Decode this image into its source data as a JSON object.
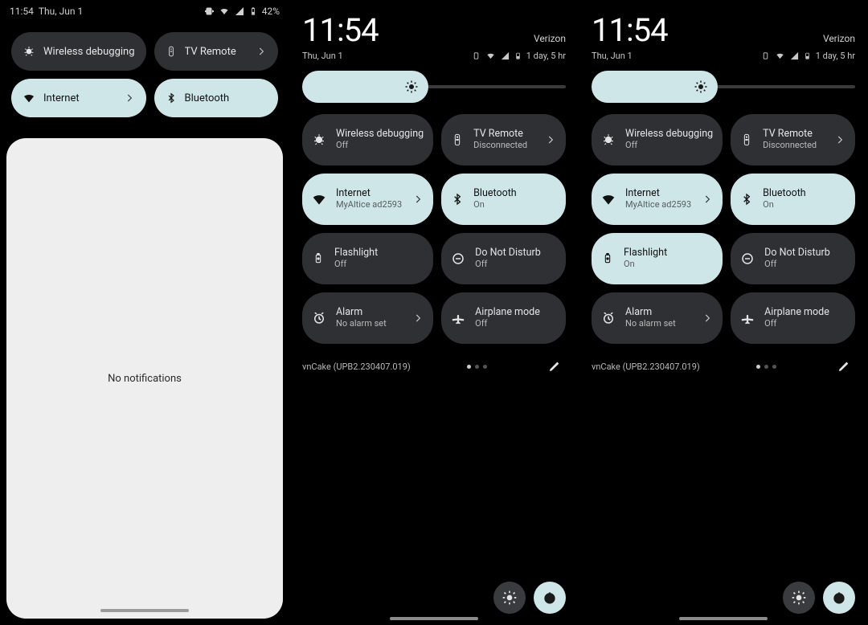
{
  "screen1": {
    "status": {
      "time": "11:54",
      "date": "Thu, Jun 1",
      "battery": "42%"
    },
    "tiles": {
      "wireless_dbg": "Wireless debugging",
      "tv_remote": "TV Remote",
      "internet": "Internet",
      "bluetooth": "Bluetooth"
    },
    "no_notifications": "No notifications"
  },
  "screen2": {
    "clock": "11:54",
    "carrier": "Verizon",
    "date": "Thu, Jun 1",
    "battery_est": "1 day, 5 hr",
    "tiles": [
      {
        "id": "wireless-debugging",
        "title": "Wireless debugging",
        "sub": "Off",
        "active": false,
        "chev": false,
        "icon": "bug"
      },
      {
        "id": "tv-remote",
        "title": "TV Remote",
        "sub": "Disconnected",
        "active": false,
        "chev": true,
        "icon": "remote"
      },
      {
        "id": "internet",
        "title": "Internet",
        "sub": "MyAltice ad2593",
        "active": true,
        "chev": true,
        "icon": "wifi"
      },
      {
        "id": "bluetooth",
        "title": "Bluetooth",
        "sub": "On",
        "active": true,
        "chev": false,
        "icon": "bt"
      },
      {
        "id": "flashlight",
        "title": "Flashlight",
        "sub": "Off",
        "active": false,
        "chev": false,
        "icon": "flash"
      },
      {
        "id": "dnd",
        "title": "Do Not Disturb",
        "sub": "Off",
        "active": false,
        "chev": false,
        "icon": "dnd"
      },
      {
        "id": "alarm",
        "title": "Alarm",
        "sub": "No alarm set",
        "active": false,
        "chev": true,
        "icon": "alarm"
      },
      {
        "id": "airplane",
        "title": "Airplane mode",
        "sub": "Off",
        "active": false,
        "chev": false,
        "icon": "plane"
      }
    ],
    "build": "vnCake (UPB2.230407.019)"
  },
  "screen3": {
    "clock": "11:54",
    "carrier": "Verizon",
    "date": "Thu, Jun 1",
    "battery_est": "1 day, 5 hr",
    "tiles": [
      {
        "id": "wireless-debugging",
        "title": "Wireless debugging",
        "sub": "Off",
        "active": false,
        "chev": false,
        "icon": "bug"
      },
      {
        "id": "tv-remote",
        "title": "TV Remote",
        "sub": "Disconnected",
        "active": false,
        "chev": true,
        "icon": "remote"
      },
      {
        "id": "internet",
        "title": "Internet",
        "sub": "MyAltice ad2593",
        "active": true,
        "chev": true,
        "icon": "wifi"
      },
      {
        "id": "bluetooth",
        "title": "Bluetooth",
        "sub": "On",
        "active": true,
        "chev": false,
        "icon": "bt"
      },
      {
        "id": "flashlight",
        "title": "Flashlight",
        "sub": "On",
        "active": true,
        "chev": false,
        "icon": "flash"
      },
      {
        "id": "dnd",
        "title": "Do Not Disturb",
        "sub": "Off",
        "active": false,
        "chev": false,
        "icon": "dnd"
      },
      {
        "id": "alarm",
        "title": "Alarm",
        "sub": "No alarm set",
        "active": false,
        "chev": true,
        "icon": "alarm"
      },
      {
        "id": "airplane",
        "title": "Airplane mode",
        "sub": "Off",
        "active": false,
        "chev": false,
        "icon": "plane"
      }
    ],
    "build": "vnCake (UPB2.230407.019)"
  }
}
